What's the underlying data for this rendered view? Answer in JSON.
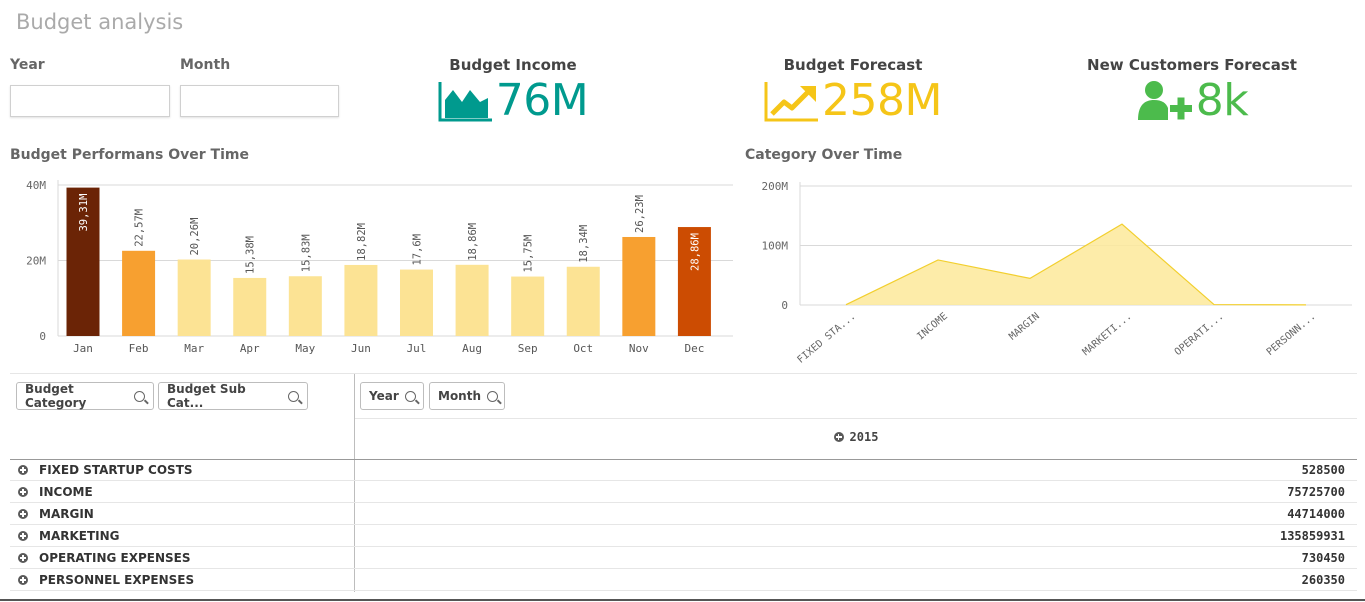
{
  "app": {
    "title": "Budget analysis"
  },
  "filters": {
    "year_label": "Year",
    "month_label": "Month",
    "year_value": "",
    "month_value": ""
  },
  "kpis": [
    {
      "title": "Budget Income",
      "value": "76M",
      "color": "#009a8e",
      "icon": "area-chart-icon"
    },
    {
      "title": "Budget Forecast",
      "value": "258M",
      "color": "#f5c518",
      "icon": "trend-up-icon"
    },
    {
      "title": "New Customers Forecast",
      "value": "8k",
      "color": "#4cbb4c",
      "icon": "add-user-icon"
    }
  ],
  "chart_data": [
    {
      "type": "bar",
      "title": "Budget Performans Over Time",
      "categories": [
        "Jan",
        "Feb",
        "Mar",
        "Apr",
        "May",
        "Jun",
        "Jul",
        "Aug",
        "Sep",
        "Oct",
        "Nov",
        "Dec"
      ],
      "values": [
        39.31,
        22.57,
        20.26,
        15.38,
        15.83,
        18.82,
        17.6,
        18.86,
        15.75,
        18.34,
        26.23,
        28.86
      ],
      "value_labels": [
        "39,31M",
        "22,57M",
        "20,26M",
        "15,38M",
        "15,83M",
        "18,82M",
        "17,6M",
        "18,86M",
        "15,75M",
        "18,34M",
        "26,23M",
        "28,86M"
      ],
      "colors": [
        "#6b2406",
        "#f7a030",
        "#fce394",
        "#fce394",
        "#fce394",
        "#fce394",
        "#fce394",
        "#fce394",
        "#fce394",
        "#fce394",
        "#f7a030",
        "#cc4c02"
      ],
      "ylim": [
        0,
        40
      ],
      "yticks": [
        "0",
        "20M",
        "40M"
      ],
      "grid": true
    },
    {
      "type": "area",
      "title": "Category Over Time",
      "categories": [
        "FIXED STA...",
        "INCOME",
        "MARGIN",
        "MARKETI...",
        "OPERATI...",
        "PERSONN..."
      ],
      "values": [
        0.5285,
        75.7257,
        44.714,
        135.859931,
        0.73045,
        0.26035
      ],
      "ylim": [
        0,
        200
      ],
      "yticks": [
        "0",
        "100M",
        "200M"
      ],
      "color": "#fde99a",
      "line_color": "#f2cf2e",
      "grid": true
    }
  ],
  "table": {
    "dimensions": [
      "Budget Category",
      "Budget Sub Cat...",
      "Year",
      "Month"
    ],
    "year_header": "2015",
    "rows": [
      {
        "label": "FIXED STARTUP COSTS",
        "value": "528500"
      },
      {
        "label": "INCOME",
        "value": "75725700"
      },
      {
        "label": "MARGIN",
        "value": "44714000"
      },
      {
        "label": "MARKETING",
        "value": "135859931"
      },
      {
        "label": "OPERATING EXPENSES",
        "value": "730450"
      },
      {
        "label": "PERSONNEL EXPENSES",
        "value": "260350"
      }
    ]
  }
}
